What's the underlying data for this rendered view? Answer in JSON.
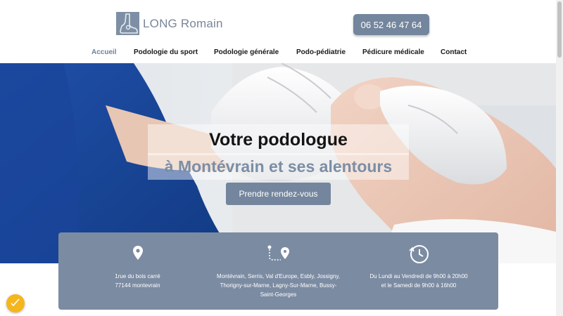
{
  "header": {
    "logo_text": "LONG Romain",
    "phone": "06 52 46 47 64"
  },
  "nav": {
    "items": [
      {
        "label": "Accueil",
        "active": true
      },
      {
        "label": "Podologie du sport",
        "active": false
      },
      {
        "label": "Podologie générale",
        "active": false
      },
      {
        "label": "Podo-pédiatrie",
        "active": false
      },
      {
        "label": "Pédicure médicale",
        "active": false
      },
      {
        "label": "Contact",
        "active": false
      }
    ]
  },
  "hero": {
    "title": "Votre podologue",
    "subtitle": "à Montévrain et ses alentours",
    "cta": "Prendre rendez-vous"
  },
  "info": {
    "address": {
      "line1": "1rue du bois carré",
      "line2": "77144 montevrain",
      "icon": "location-pin-icon"
    },
    "area": {
      "text": "Montévrain, Serris, Val d'Europe, Esbly, Jossigny, Thorigny-sur-Marne, Lagny-Sur-Marne, Bussy-Saint-Georges",
      "icon": "route-icon"
    },
    "hours": {
      "line1": "Du Lundi au Vendredi de 9h00 à 20h00",
      "line2": "et le Samedi de 9h00 à 16h00",
      "icon": "clock-icon"
    }
  },
  "colors": {
    "accent": "#74869e",
    "info_bg": "#7b8ba2",
    "cookie": "#f5b51c"
  }
}
